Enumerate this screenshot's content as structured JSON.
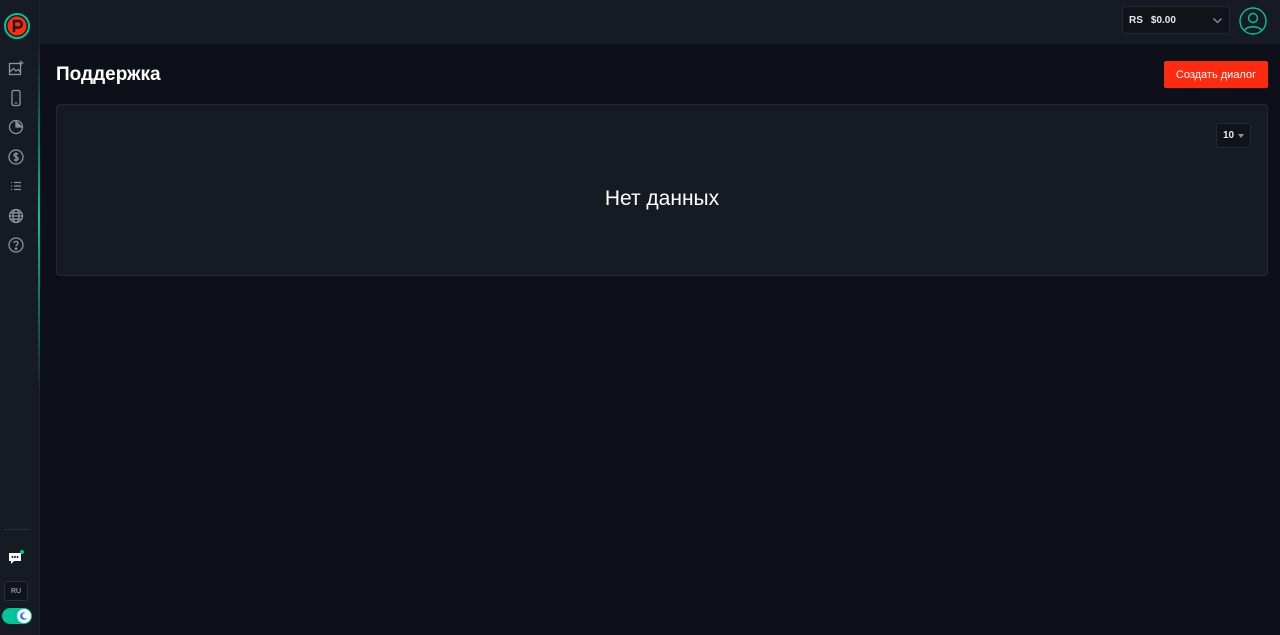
{
  "header": {
    "balance_currency": "RS",
    "balance_amount": "$0.00"
  },
  "sidebar": {
    "items": [
      {
        "icon": "add-image-icon"
      },
      {
        "icon": "mobile-phone-icon"
      },
      {
        "icon": "pie-chart-icon"
      },
      {
        "icon": "dollar-icon"
      },
      {
        "icon": "list-icon"
      },
      {
        "icon": "globe-icon"
      },
      {
        "icon": "help-icon"
      }
    ],
    "language": "RU"
  },
  "main": {
    "title": "Поддержка",
    "create_button": "Создать диалог",
    "page_size": "10",
    "empty_text": "Нет данных"
  },
  "colors": {
    "accent": "#00c49a",
    "primary_button": "#ff2b10",
    "background": "#0d1018",
    "surface": "#161a22"
  }
}
